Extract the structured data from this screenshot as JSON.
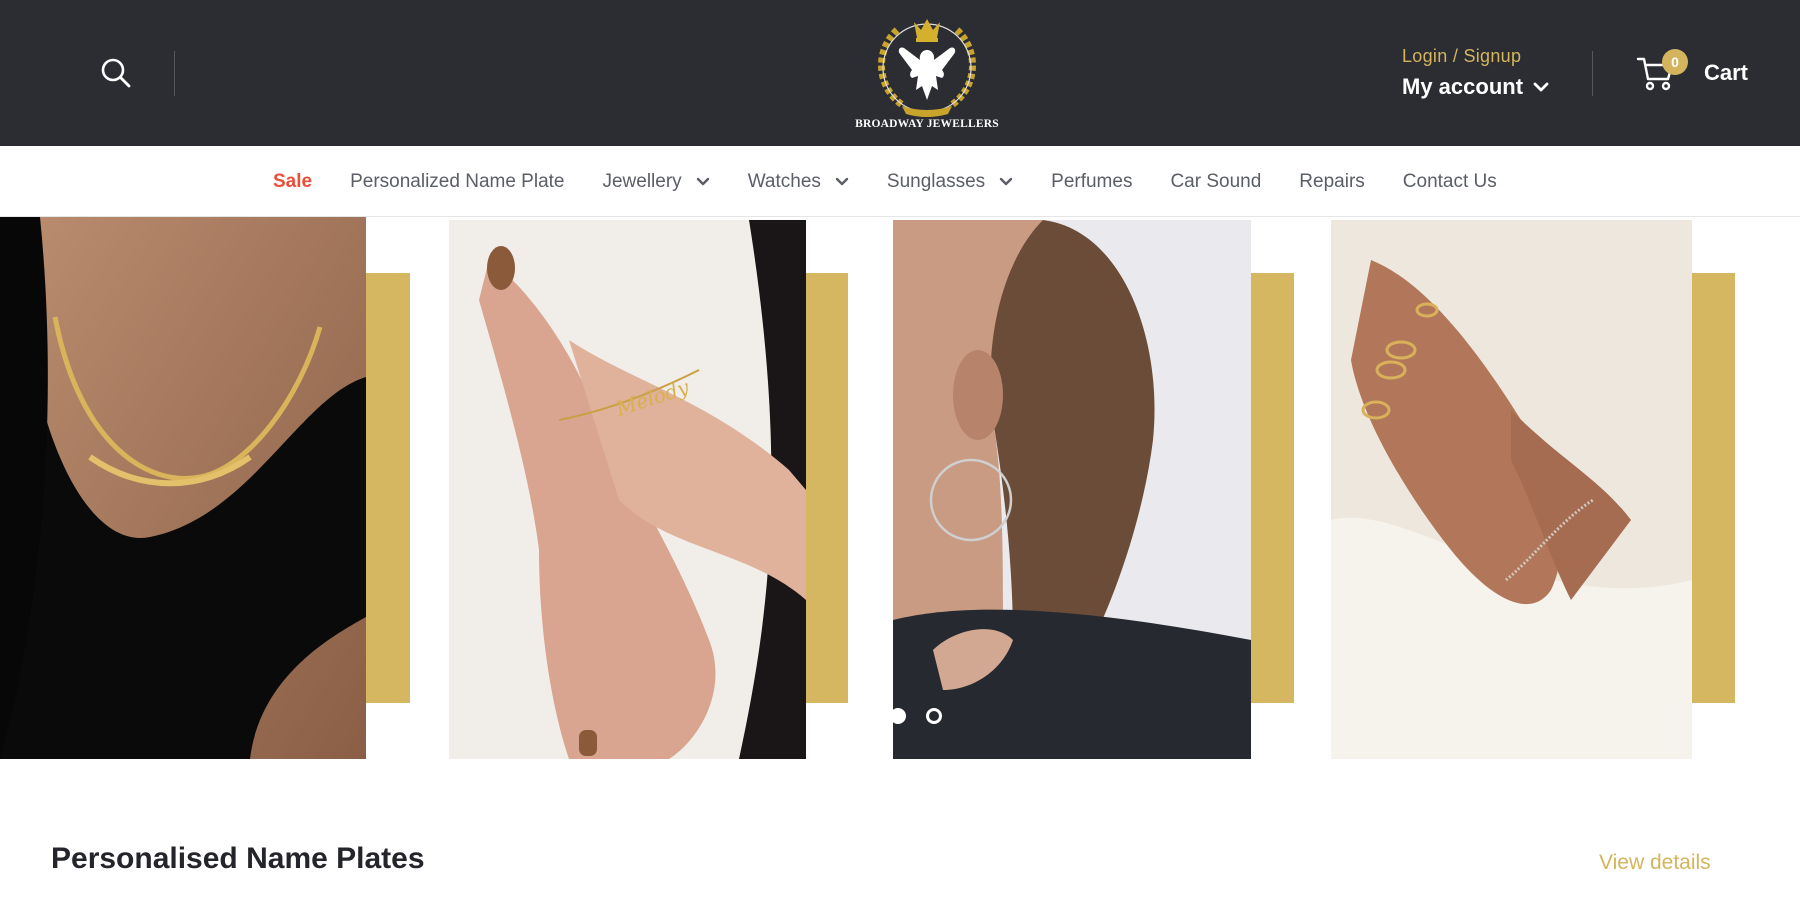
{
  "header": {
    "search_icon": "search-icon",
    "logo_text": "BROADWAY JEWELLERS",
    "login_label": "Login / Signup",
    "account_label": "My account",
    "cart_count": "0",
    "cart_label": "Cart"
  },
  "nav": {
    "items": [
      {
        "label": "Sale"
      },
      {
        "label": "Personalized Name Plate"
      },
      {
        "label": "Jewellery"
      },
      {
        "label": "Watches"
      },
      {
        "label": "Sunglasses"
      },
      {
        "label": "Perfumes"
      },
      {
        "label": "Car Sound"
      },
      {
        "label": "Repairs"
      },
      {
        "label": "Contact Us"
      }
    ]
  },
  "hero": {
    "bracelet_engraving": "Melody",
    "slide_count": 2,
    "active_slide": 1
  },
  "section": {
    "title": "Personalised Name Plates",
    "view_details_label": "View details"
  },
  "colors": {
    "header_bg": "#2b2d33",
    "accent_gold": "#d4b45c",
    "sale_red": "#e8503a",
    "nav_text": "#5a5e66"
  }
}
